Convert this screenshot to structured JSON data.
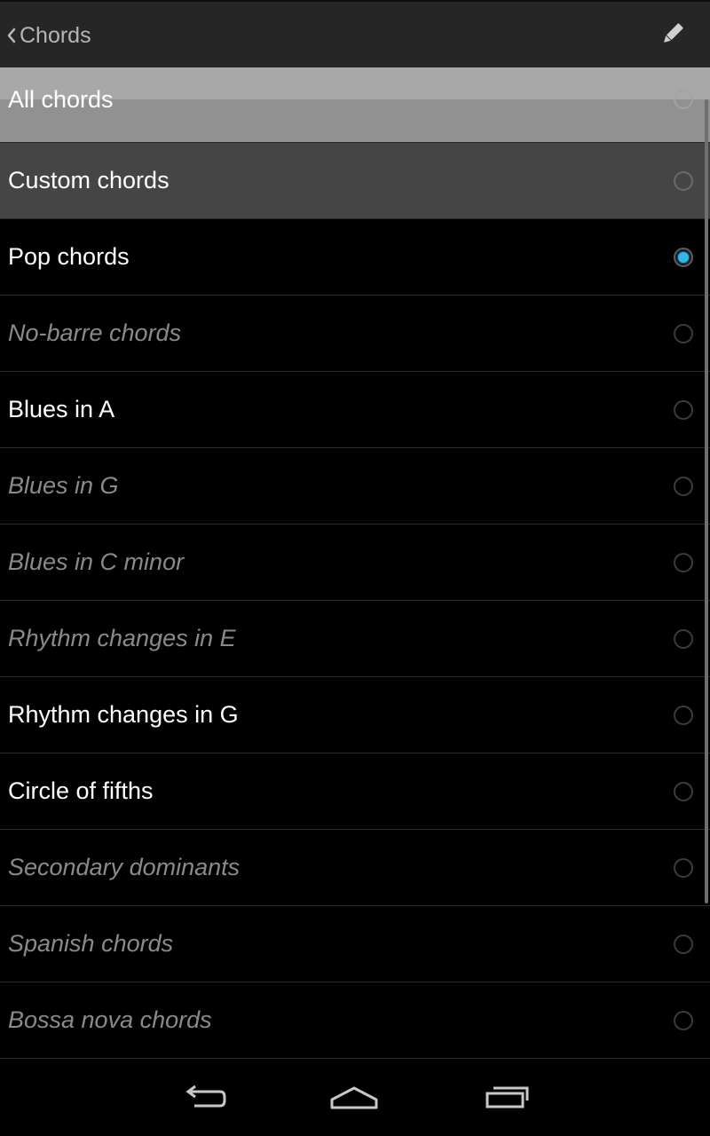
{
  "action_bar": {
    "title": "Chords",
    "up_icon": "chevron-left-icon",
    "edit_icon": "pencil-icon"
  },
  "chord_sets": [
    {
      "label": "All chords",
      "selected": false,
      "enabled": true
    },
    {
      "label": "Custom chords",
      "selected": false,
      "enabled": true
    },
    {
      "label": "Pop chords",
      "selected": true,
      "enabled": true
    },
    {
      "label": "No-barre chords",
      "selected": false,
      "enabled": false
    },
    {
      "label": "Blues in A",
      "selected": false,
      "enabled": true
    },
    {
      "label": "Blues in G",
      "selected": false,
      "enabled": false
    },
    {
      "label": "Blues in C minor",
      "selected": false,
      "enabled": false
    },
    {
      "label": "Rhythm changes in E",
      "selected": false,
      "enabled": false
    },
    {
      "label": "Rhythm changes in G",
      "selected": false,
      "enabled": true
    },
    {
      "label": "Circle of fifths",
      "selected": false,
      "enabled": true
    },
    {
      "label": "Secondary dominants",
      "selected": false,
      "enabled": false
    },
    {
      "label": "Spanish chords",
      "selected": false,
      "enabled": false
    },
    {
      "label": "Bossa nova chords",
      "selected": false,
      "enabled": false
    }
  ],
  "nav_bar": {
    "back_icon": "back-icon",
    "home_icon": "home-icon",
    "recents_icon": "recent-apps-icon"
  },
  "colors": {
    "accent": "#33b5e5",
    "action_bar_bg": "#262626",
    "disabled_text": "#8a8a8a"
  }
}
